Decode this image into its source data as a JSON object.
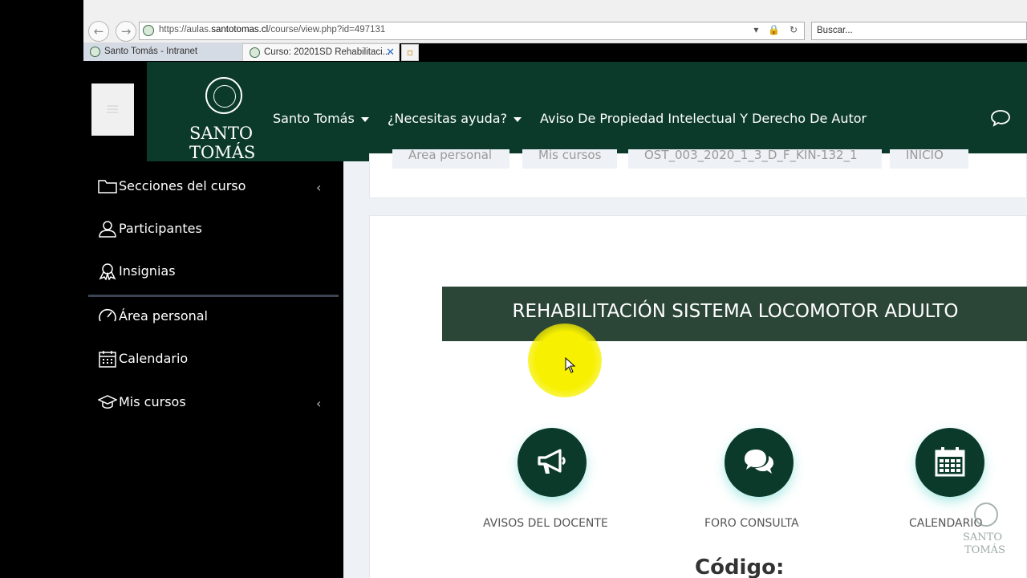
{
  "browser": {
    "url_host": "https://aulas.",
    "url_domain": "santotomas.cl",
    "url_path": "/course/view.php?id=497131",
    "search_placeholder": "Buscar...",
    "tabs": [
      {
        "title": "Santo Tomás - Intranet",
        "active": false
      },
      {
        "title": "Curso: 20201SD Rehabilitaci...",
        "active": true
      }
    ]
  },
  "header": {
    "logo_line1": "SANTO",
    "logo_line2": "TOMÁS",
    "nav": [
      {
        "label": "Santo Tomás",
        "dropdown": true
      },
      {
        "label": "¿Necesitas ayuda?",
        "dropdown": true
      },
      {
        "label": "Aviso De Propiedad Intelectual Y Derecho De Autor",
        "dropdown": false
      }
    ],
    "bg_color": "#0b3a2b"
  },
  "sidebar": {
    "items": [
      {
        "label": "Secciones del curso",
        "icon": "folder-icon",
        "chevron": true
      },
      {
        "label": "Participantes",
        "icon": "participants-icon",
        "chevron": false
      },
      {
        "label": "Insignias",
        "icon": "badge-icon",
        "chevron": false
      },
      {
        "label": "Área personal",
        "icon": "dashboard-icon",
        "chevron": false
      },
      {
        "label": "Calendario",
        "icon": "calendar-icon",
        "chevron": false
      },
      {
        "label": "Mis cursos",
        "icon": "graduation-cap-icon",
        "chevron": true
      }
    ]
  },
  "breadcrumb": [
    "Área personal",
    "Mis cursos",
    "OST_003_2020_1_3_D_F_KIN-132_1",
    "INICIO"
  ],
  "course": {
    "title": "REHABILITACIÓN SISTEMA LOCOMOTOR ADULTO",
    "banner_color": "#2b4537",
    "buttons": [
      {
        "label": "AVISOS DEL DOCENTE",
        "icon": "megaphone-icon"
      },
      {
        "label": "FORO CONSULTA",
        "icon": "chat-bubbles-icon"
      },
      {
        "label": "CALENDARIO",
        "icon": "calendar-icon"
      }
    ],
    "section_heading": "Código:"
  },
  "watermark": {
    "line1": "SANTO",
    "line2": "TOMÁS"
  }
}
